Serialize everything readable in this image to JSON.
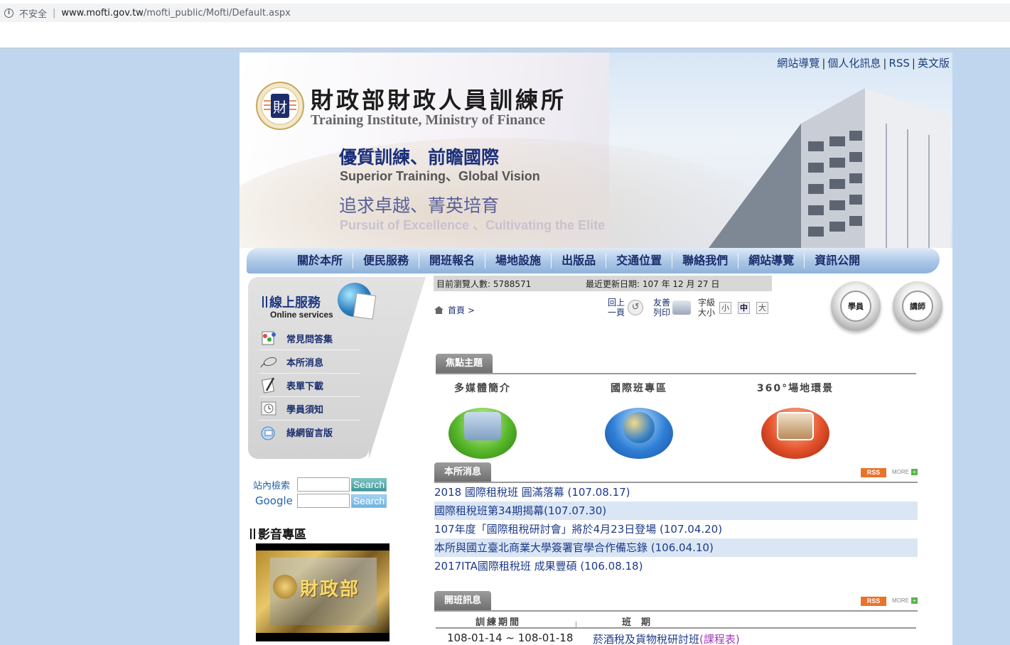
{
  "browser": {
    "security_label": "不安全",
    "url_host": "www.mofti.gov.tw",
    "url_path": "/mofti_public/Mofti/Default.aspx"
  },
  "header": {
    "top_links": [
      "網站導覽",
      "個人化訊息",
      "RSS",
      "英文版"
    ],
    "org_name_zh": "財政部財政人員訓練所",
    "org_name_en": "Training Institute, Ministry of Finance",
    "slogan1_zh": "優質訓練、前瞻國際",
    "slogan1_en": "Superior Training、Global Vision",
    "slogan2_zh": "追求卓越、菁英培育",
    "slogan2_en": "Pursuit of Excellence 、Cultivating the Elite"
  },
  "nav": {
    "items": [
      "關於本所",
      "便民服務",
      "開班報名",
      "場地設施",
      "出版品",
      "交通位置",
      "聯絡我們",
      "網站導覽",
      "資訊公開"
    ]
  },
  "online_services": {
    "title_zh": "線上服務",
    "title_en": "Online services",
    "items": [
      {
        "label": "常見問答集",
        "icon": "faq-icon"
      },
      {
        "label": "本所消息",
        "icon": "mouse-icon"
      },
      {
        "label": "表單下載",
        "icon": "pen-icon"
      },
      {
        "label": "學員須知",
        "icon": "clock-icon"
      },
      {
        "label": "綠網留言版",
        "icon": "message-icon"
      }
    ]
  },
  "site_search": {
    "label_site": "站內檢索",
    "label_google": "Google",
    "button_label": "Search",
    "site_value": "",
    "google_value": ""
  },
  "av": {
    "title": "影音專區",
    "video_text": "財政部"
  },
  "status_bar": {
    "visitors": "目前瀏覽人數: 5788571",
    "updated": "最近更新日期: 107 年 12 月 27 日"
  },
  "breadcrumb": {
    "home": "首頁",
    "sep": ">"
  },
  "tools": {
    "back_line1": "回上",
    "back_line2": "一頁",
    "print_line1": "友善",
    "print_line2": "列印",
    "font_line1": "字級",
    "font_line2": "大小",
    "font_small": "小",
    "font_medium": "中",
    "font_large": "大"
  },
  "role_buttons": {
    "student": "學員",
    "teacher": "講師"
  },
  "focus": {
    "title": "焦點主題",
    "items": [
      {
        "label": "多媒體簡介",
        "color": "#58b82a"
      },
      {
        "label": "國際班專區",
        "color": "#2f7fd6"
      },
      {
        "label": "360°場地環景",
        "color": "#e3512a"
      }
    ]
  },
  "news": {
    "title": "本所消息",
    "rss": "RSS",
    "more": "MORE",
    "items": [
      "2018 國際租稅班 圓滿落幕 (107.08.17)",
      "國際租稅班第34期揭幕(107.07.30)",
      "107年度「國際租稅研討會」將於4月23日登場 (107.04.20)",
      "本所與國立臺北商業大學簽署官學合作備忘錄 (106.04.10)",
      "2017ITA國際租稅班 成果豐碩 (106.08.18)"
    ]
  },
  "classes": {
    "title": "開班訊息",
    "rss": "RSS",
    "more": "MORE",
    "col_period": "訓練期間",
    "col_class": "班期",
    "rows": [
      {
        "period": "108-01-14 ~ 108-01-18",
        "name": "菸酒稅及貨物稅研討班",
        "syllabus": "(課程表)"
      }
    ]
  }
}
